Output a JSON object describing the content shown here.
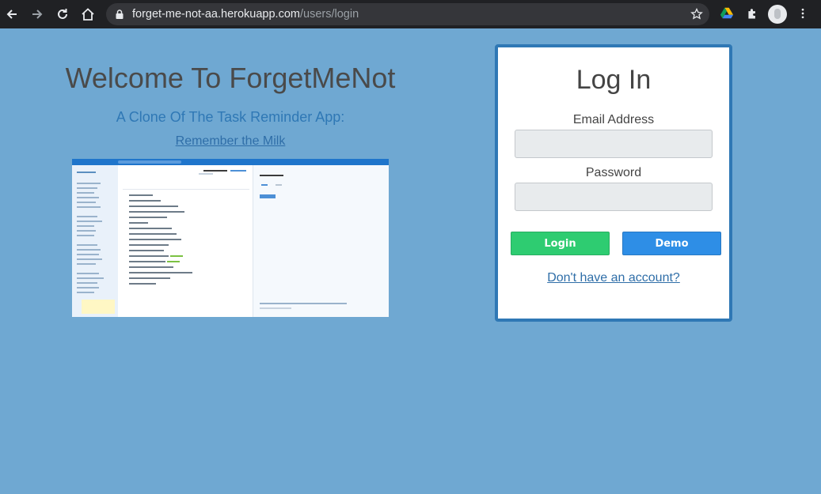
{
  "browser": {
    "url_host": "forget-me-not-aa.herokuapp.com",
    "url_path": "/users/login"
  },
  "welcome": {
    "title": "Welcome To ForgetMeNot",
    "subtitle": "A Clone Of The Task Reminder App:",
    "link_text": "Remember the Milk"
  },
  "login": {
    "title": "Log In",
    "email_label": "Email Address",
    "email_value": "",
    "password_label": "Password",
    "password_value": "",
    "login_button": "Login",
    "demo_button": "Demo",
    "signup_link": "Don't have an account?"
  },
  "colors": {
    "background": "#6fa8d2",
    "card_border": "#2f78b5",
    "login_button": "#2ecc71",
    "demo_button": "#2e8ee6"
  }
}
